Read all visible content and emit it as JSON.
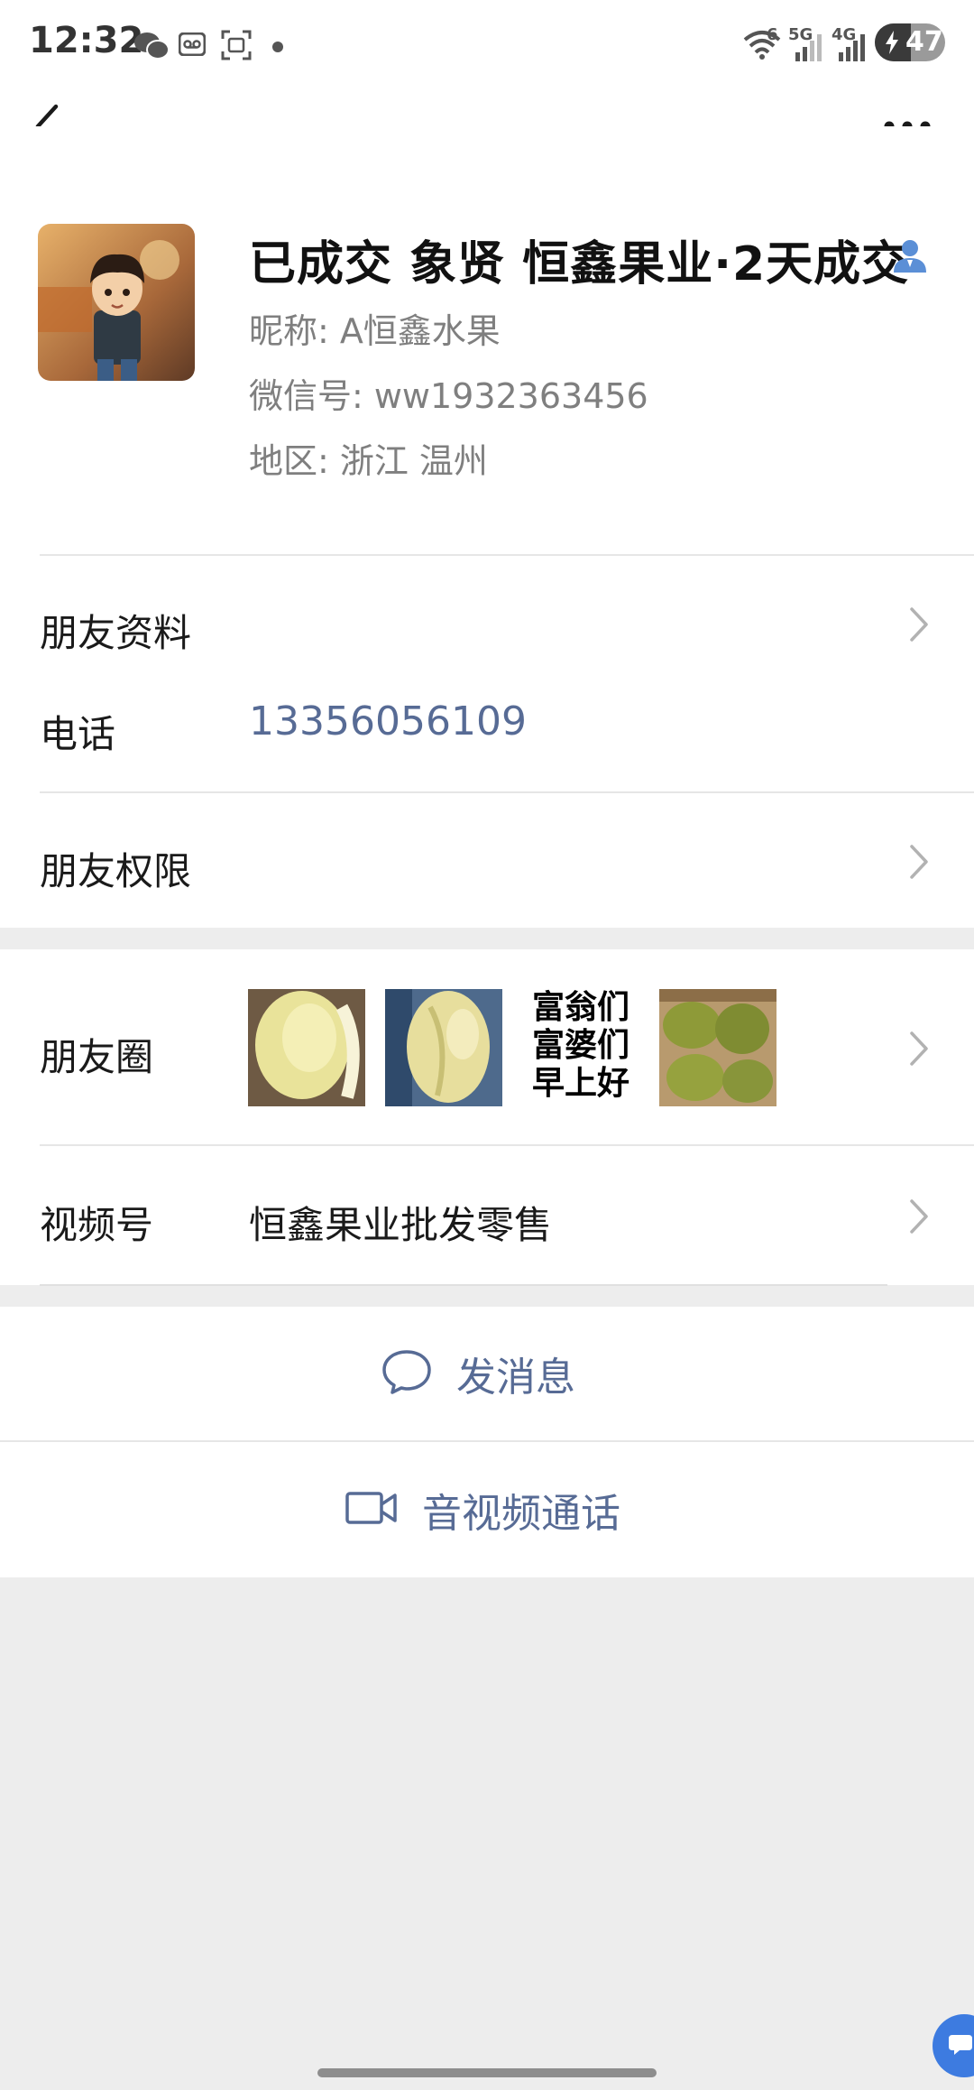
{
  "status_bar": {
    "time": "12:32",
    "network_5g": "5G",
    "network_4g": "4G",
    "wifi_level": "6",
    "battery": "47",
    "icons": [
      "wechat-icon",
      "voicemail-icon",
      "screenshot-icon",
      "dot-icon",
      "wifi-icon",
      "signal-icon",
      "battery-charging-icon"
    ]
  },
  "nav": {
    "back_icon": "chevron-left-icon",
    "more_icon": "more-dots-icon"
  },
  "profile": {
    "display_name": "已成交 象贤  恒鑫果业·2天成交",
    "nickname_label": "昵称:",
    "nickname": "A恒鑫水果",
    "wechat_id_label": "微信号:",
    "wechat_id": "ww1932363456",
    "region_label": "地区:",
    "region_province": "浙江",
    "region_city": "温州"
  },
  "rows": {
    "friend_info": "朋友资料",
    "phone_label": "电话",
    "phone_value": "13356056109",
    "permissions": "朋友权限",
    "moments": "朋友圈",
    "moments_text_thumb": [
      "富翁们",
      "富婆们",
      "早上好"
    ],
    "channels_label": "视频号",
    "channels_value": "恒鑫果业批发零售"
  },
  "actions": {
    "message": "发消息",
    "call": "音视频通话"
  },
  "colors": {
    "link": "#576b95",
    "background": "#ededed",
    "card": "#ffffff",
    "contact_icon": "#5b8fd6"
  }
}
